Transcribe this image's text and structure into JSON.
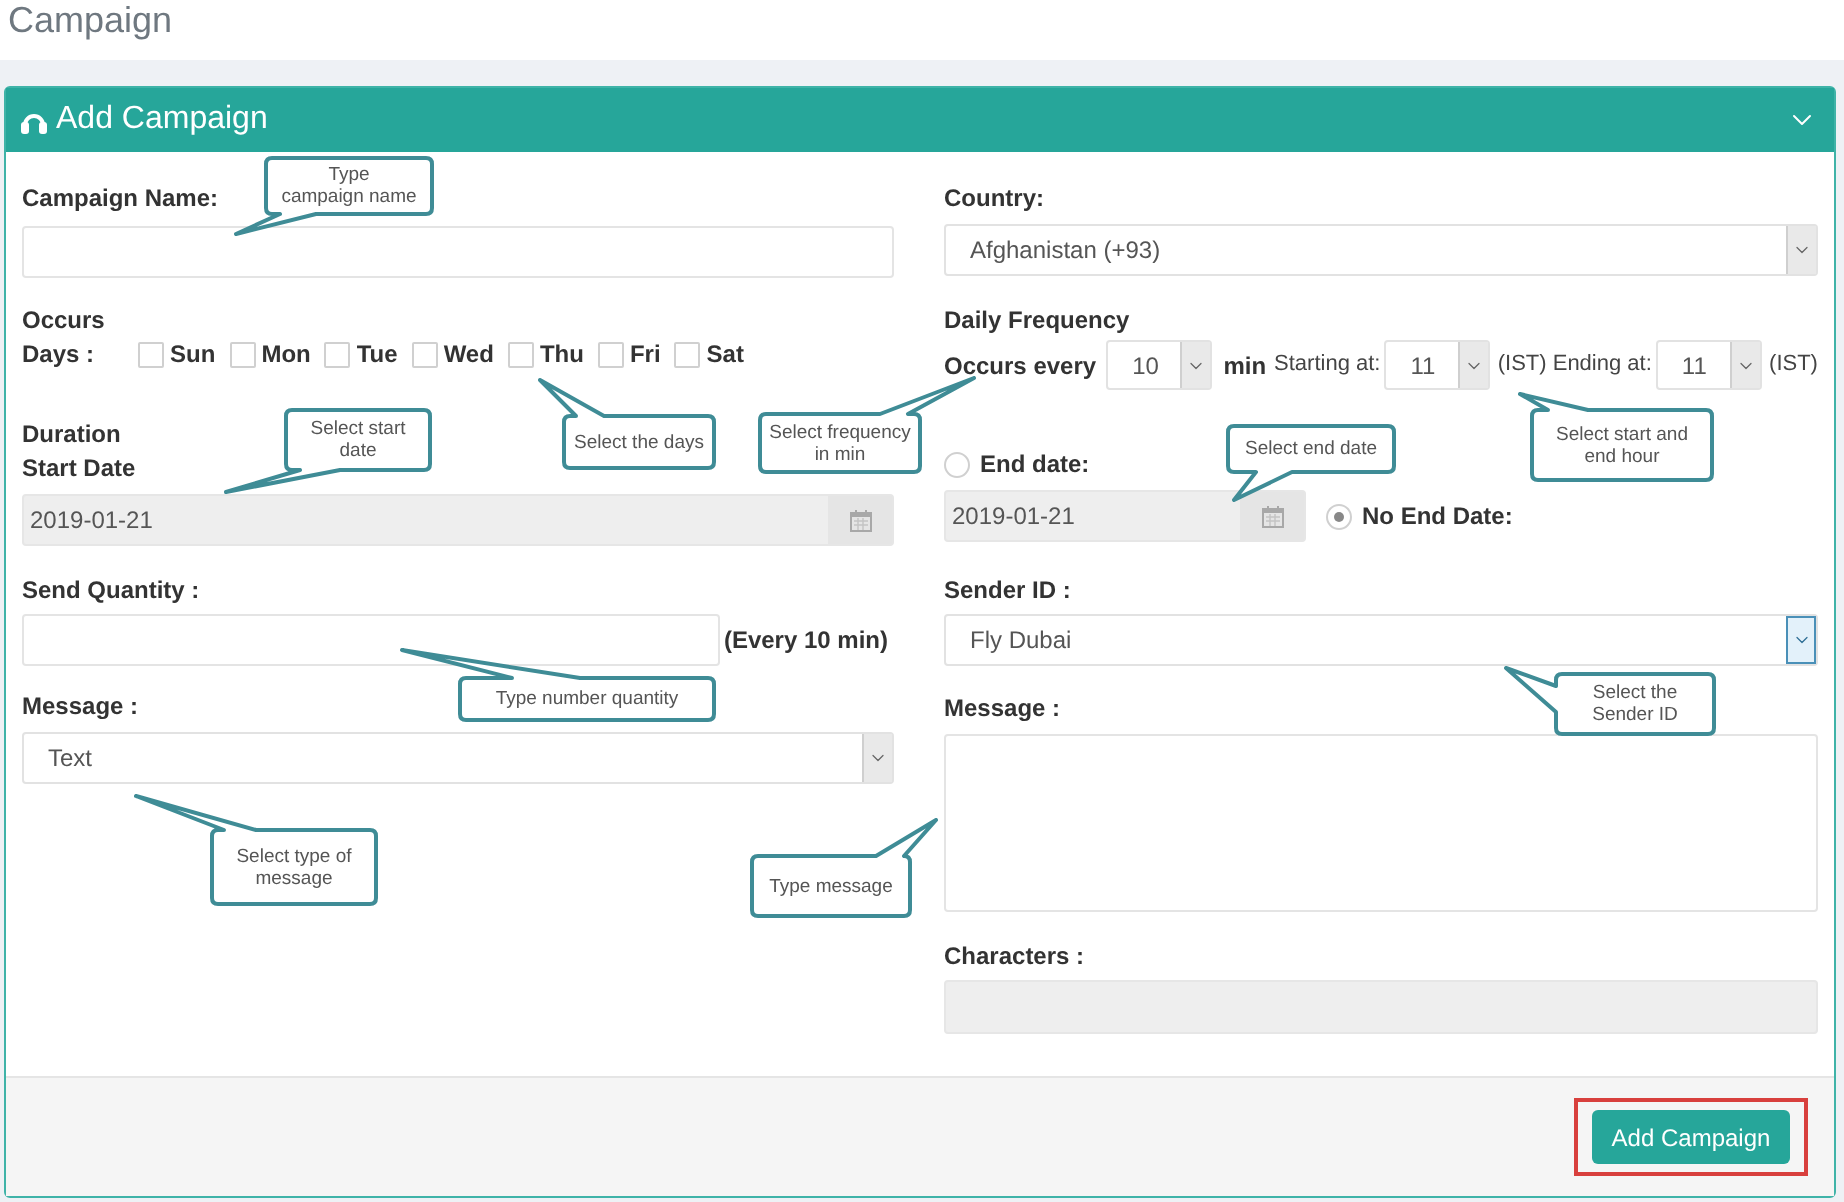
{
  "page_title": "Campaign",
  "panel": {
    "title": "Add Campaign"
  },
  "campaign_name": {
    "label": "Campaign Name:"
  },
  "occurs": {
    "heading": "Occurs",
    "days_label": "Days :",
    "days": [
      {
        "label": "Sun",
        "checked": false
      },
      {
        "label": "Mon",
        "checked": false
      },
      {
        "label": "Tue",
        "checked": false
      },
      {
        "label": "Wed",
        "checked": false
      },
      {
        "label": "Thu",
        "checked": false
      },
      {
        "label": "Fri",
        "checked": false
      },
      {
        "label": "Sat",
        "checked": false
      }
    ]
  },
  "duration": {
    "heading": "Duration",
    "label": "Start Date",
    "value": "2019-01-21",
    "disabled": true
  },
  "send_quantity": {
    "label": "Send Quantity :",
    "suffix": "(Every 10 min)"
  },
  "message_type": {
    "label": "Message :",
    "value": "Text"
  },
  "country": {
    "label": "Country:",
    "value": "Afghanistan (+93)"
  },
  "daily_frequency": {
    "heading": "Daily Frequency",
    "parts": [
      {
        "kind": "bold",
        "text": "Occurs every"
      },
      {
        "kind": "select",
        "value": "10"
      },
      {
        "kind": "bold",
        "text": "min"
      },
      {
        "kind": "plain",
        "text": "Starting at:"
      },
      {
        "kind": "select",
        "value": "11"
      },
      {
        "kind": "plain",
        "text": "(IST) Ending at:"
      },
      {
        "kind": "select",
        "value": "11"
      },
      {
        "kind": "plain",
        "text": "(IST)"
      }
    ]
  },
  "end_options": [
    {
      "label": "End date:",
      "selected": false
    },
    {
      "label": "No End Date:",
      "selected": true
    }
  ],
  "end_date": {
    "value": "2019-01-21",
    "disabled": true
  },
  "sender_id": {
    "label": "Sender ID :",
    "value": "Fly Dubai",
    "focused": true
  },
  "message": {
    "label": "Message :"
  },
  "characters": {
    "label": "Characters :",
    "disabled": true
  },
  "footer": {
    "button": {
      "label": "Add Campaign",
      "highlighted": true
    }
  },
  "annotations": [
    {
      "lines": [
        "Type",
        "campaign name"
      ]
    },
    {
      "lines": [
        "Select start",
        "date"
      ]
    },
    {
      "lines": [
        "Select the days"
      ]
    },
    {
      "lines": [
        "Select frequency",
        "in min"
      ]
    },
    {
      "lines": [
        "Select end date"
      ]
    },
    {
      "lines": [
        "Select start and",
        "end hour"
      ]
    },
    {
      "lines": [
        "Type number quantity"
      ]
    },
    {
      "lines": [
        "Select the",
        "Sender ID"
      ]
    },
    {
      "lines": [
        "Select type of",
        "message"
      ]
    },
    {
      "lines": [
        "Type message"
      ]
    }
  ]
}
